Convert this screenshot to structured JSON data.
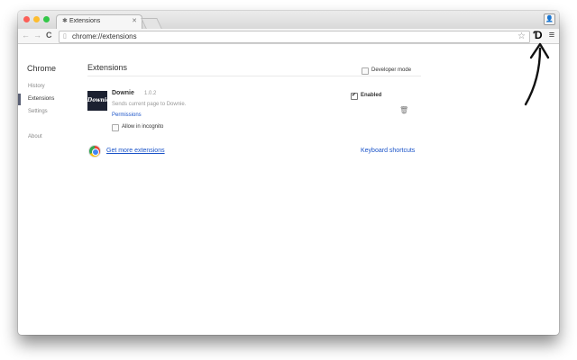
{
  "tab": {
    "title": "Extensions",
    "icon": "puzzle-icon"
  },
  "toolbar": {
    "url": "chrome://extensions",
    "back_icon": "back-icon",
    "forward_icon": "forward-icon",
    "reload_icon": "reload-icon",
    "extension_icon": "downie-extension-icon",
    "menu_icon": "hamburger-menu-icon"
  },
  "sidebar": {
    "title": "Chrome",
    "items": [
      {
        "label": "History"
      },
      {
        "label": "Extensions",
        "active": true
      },
      {
        "label": "Settings"
      },
      {
        "label": "About"
      }
    ]
  },
  "main": {
    "title": "Extensions",
    "developer_mode": {
      "label": "Developer mode",
      "checked": false
    },
    "extension": {
      "icon_text": "Downie",
      "name": "Downie",
      "version": "1.0.2",
      "description": "Sends current page to Downie.",
      "permissions_link": "Permissions",
      "incognito_label": "Allow in incognito",
      "incognito_checked": false,
      "enabled_label": "Enabled",
      "enabled_checked": true
    },
    "get_more": "Get more extensions",
    "keyboard_shortcuts": "Keyboard shortcuts"
  },
  "colors": {
    "link": "#1a53c8",
    "sidebar_marker": "#5a6075",
    "extension_icon_bg": "#1c2131"
  }
}
